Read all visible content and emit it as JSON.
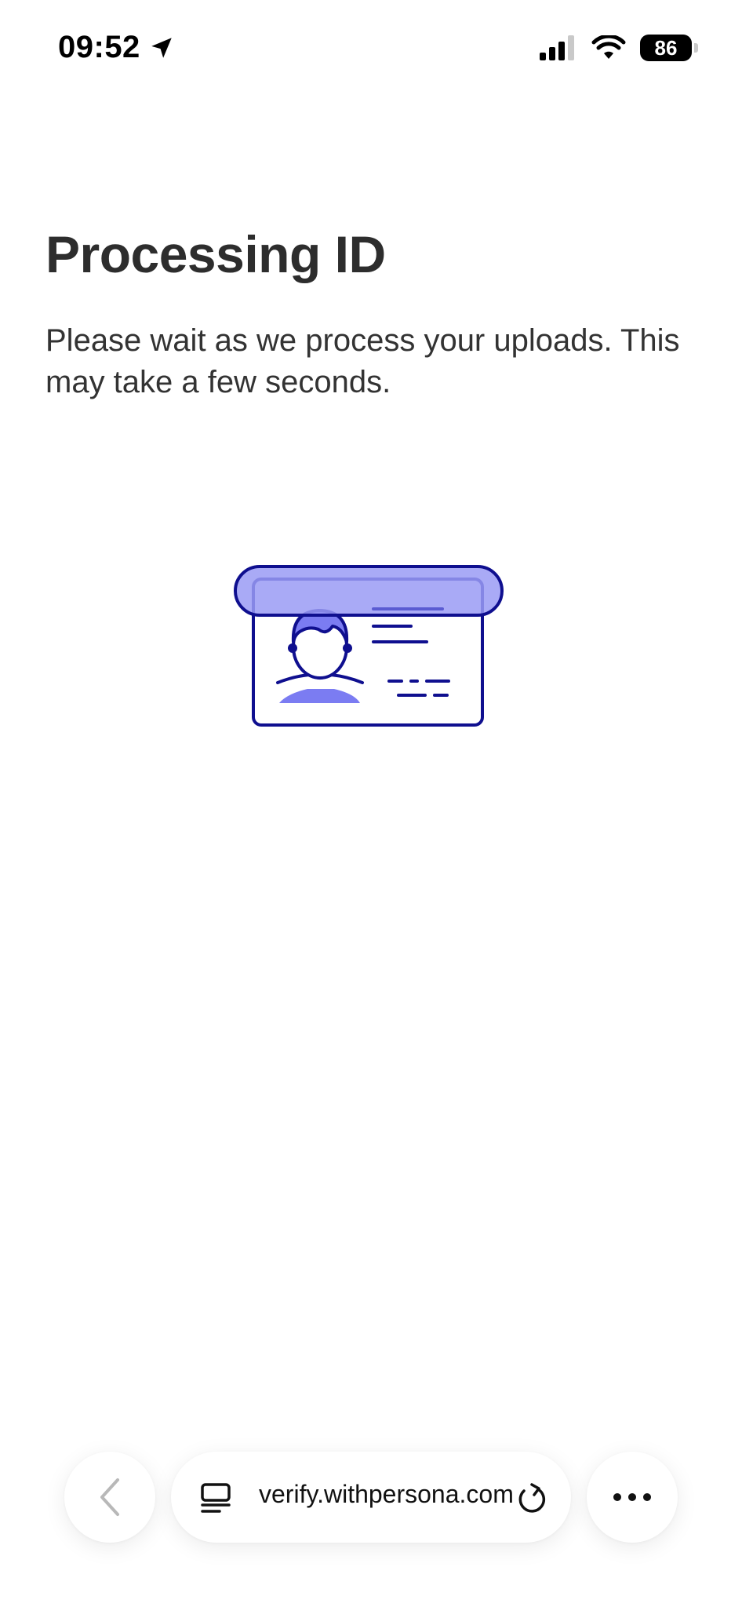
{
  "status_bar": {
    "time": "09:52",
    "battery": "86",
    "icons": [
      "location-arrow-icon",
      "cellular-signal-icon",
      "wifi-icon",
      "battery-icon"
    ]
  },
  "main": {
    "title": "Processing ID",
    "description": "Please wait as we process your uploads. This may take a few seconds.",
    "illustration": "id-card-scanning-illustration"
  },
  "colors": {
    "accent_dark": "#0f0f8f",
    "accent_fill": "#7b7cf2",
    "scan_bar_fill": "#9a9bf5",
    "text": "#2f2f2f"
  },
  "browser_toolbar": {
    "url": "verify.withpersona.com",
    "icons": [
      "chevron-left-icon",
      "tabs-icon",
      "reload-icon",
      "more-dots-icon"
    ]
  }
}
